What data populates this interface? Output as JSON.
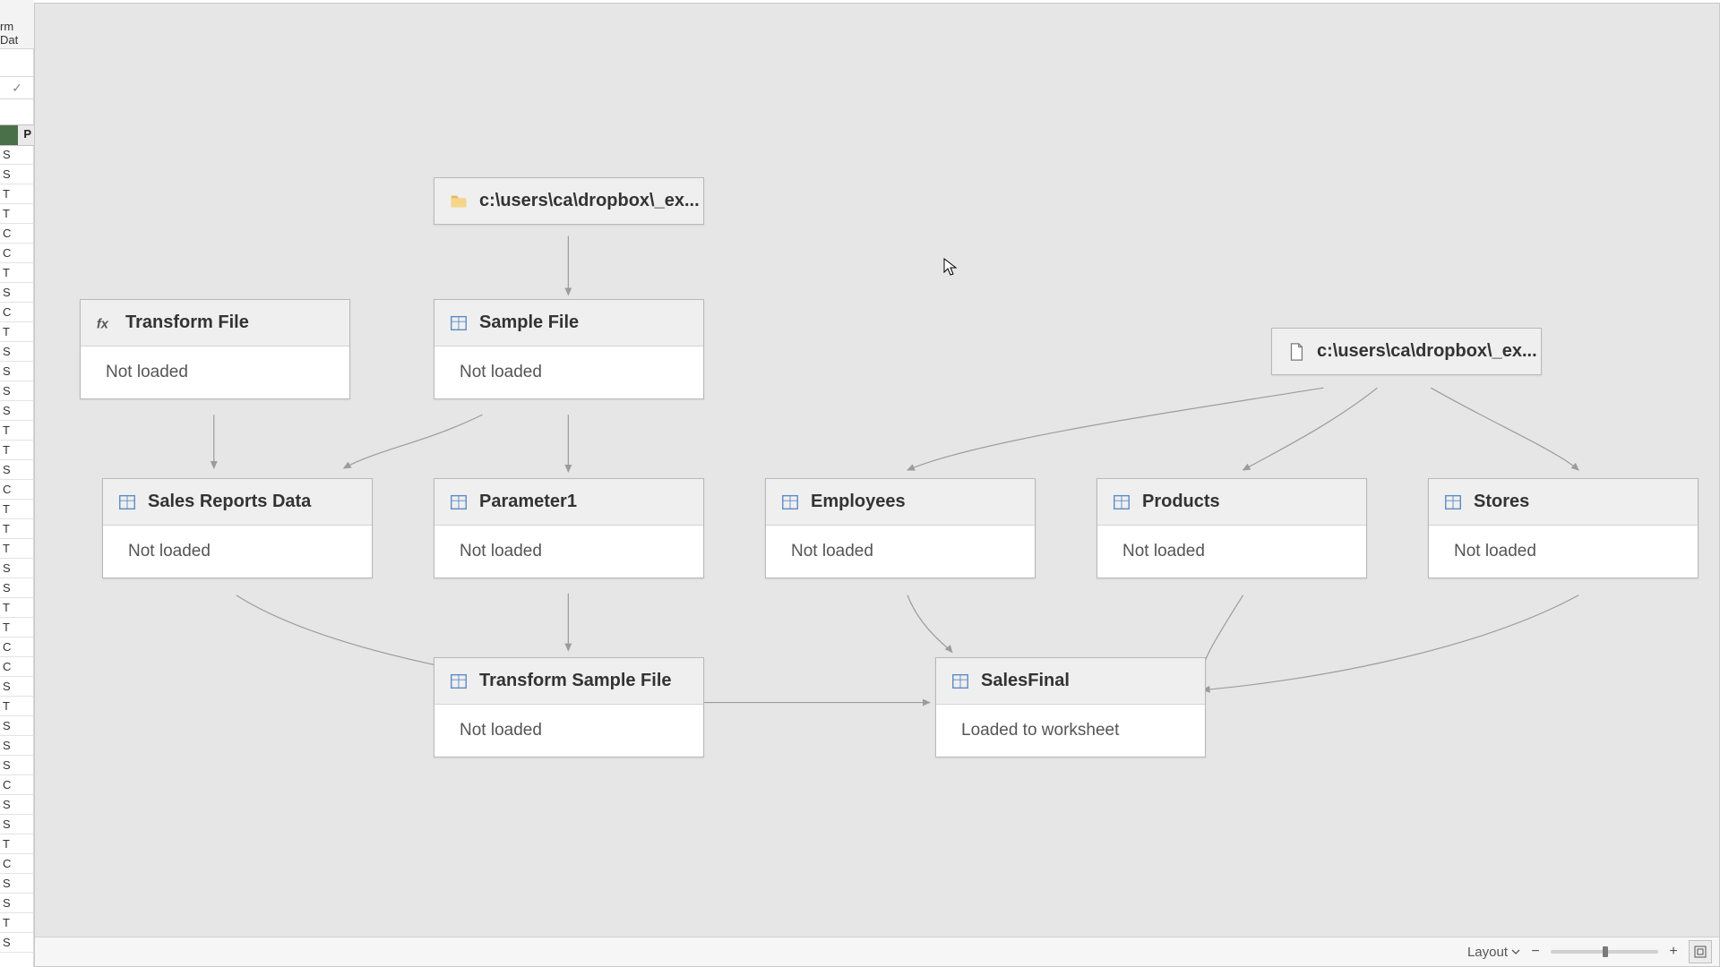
{
  "left_strip": {
    "ribbon_label": "rm Dat",
    "col_header": "P",
    "fx_mark": "✓",
    "cells": [
      "S",
      "S",
      "T",
      "T",
      "C",
      "C",
      "T",
      "S",
      "C",
      "T",
      "S",
      "S",
      "S",
      "S",
      "T",
      "T",
      "S",
      "C",
      "T",
      "T",
      "T",
      "S",
      "S",
      "T",
      "T",
      "C",
      "C",
      "S",
      "T",
      "S",
      "S",
      "S",
      "C",
      "S",
      "S",
      "T",
      "C",
      "S",
      "S",
      "T",
      "S"
    ]
  },
  "nodes": {
    "src_folder": {
      "label": "c:\\users\\ca\\dropbox\\_ex..."
    },
    "src_file": {
      "label": "c:\\users\\ca\\dropbox\\_ex..."
    },
    "transform_file": {
      "title": "Transform File",
      "status": "Not loaded"
    },
    "sample_file": {
      "title": "Sample File",
      "status": "Not loaded"
    },
    "sales_reports": {
      "title": "Sales Reports Data",
      "status": "Not loaded"
    },
    "parameter1": {
      "title": "Parameter1",
      "status": "Not loaded"
    },
    "employees": {
      "title": "Employees",
      "status": "Not loaded"
    },
    "products": {
      "title": "Products",
      "status": "Not loaded"
    },
    "stores": {
      "title": "Stores",
      "status": "Not loaded"
    },
    "transform_sample": {
      "title": "Transform Sample File",
      "status": "Not loaded"
    },
    "sales_final": {
      "title": "SalesFinal",
      "status": "Loaded to worksheet"
    }
  },
  "footer": {
    "layout": "Layout"
  }
}
